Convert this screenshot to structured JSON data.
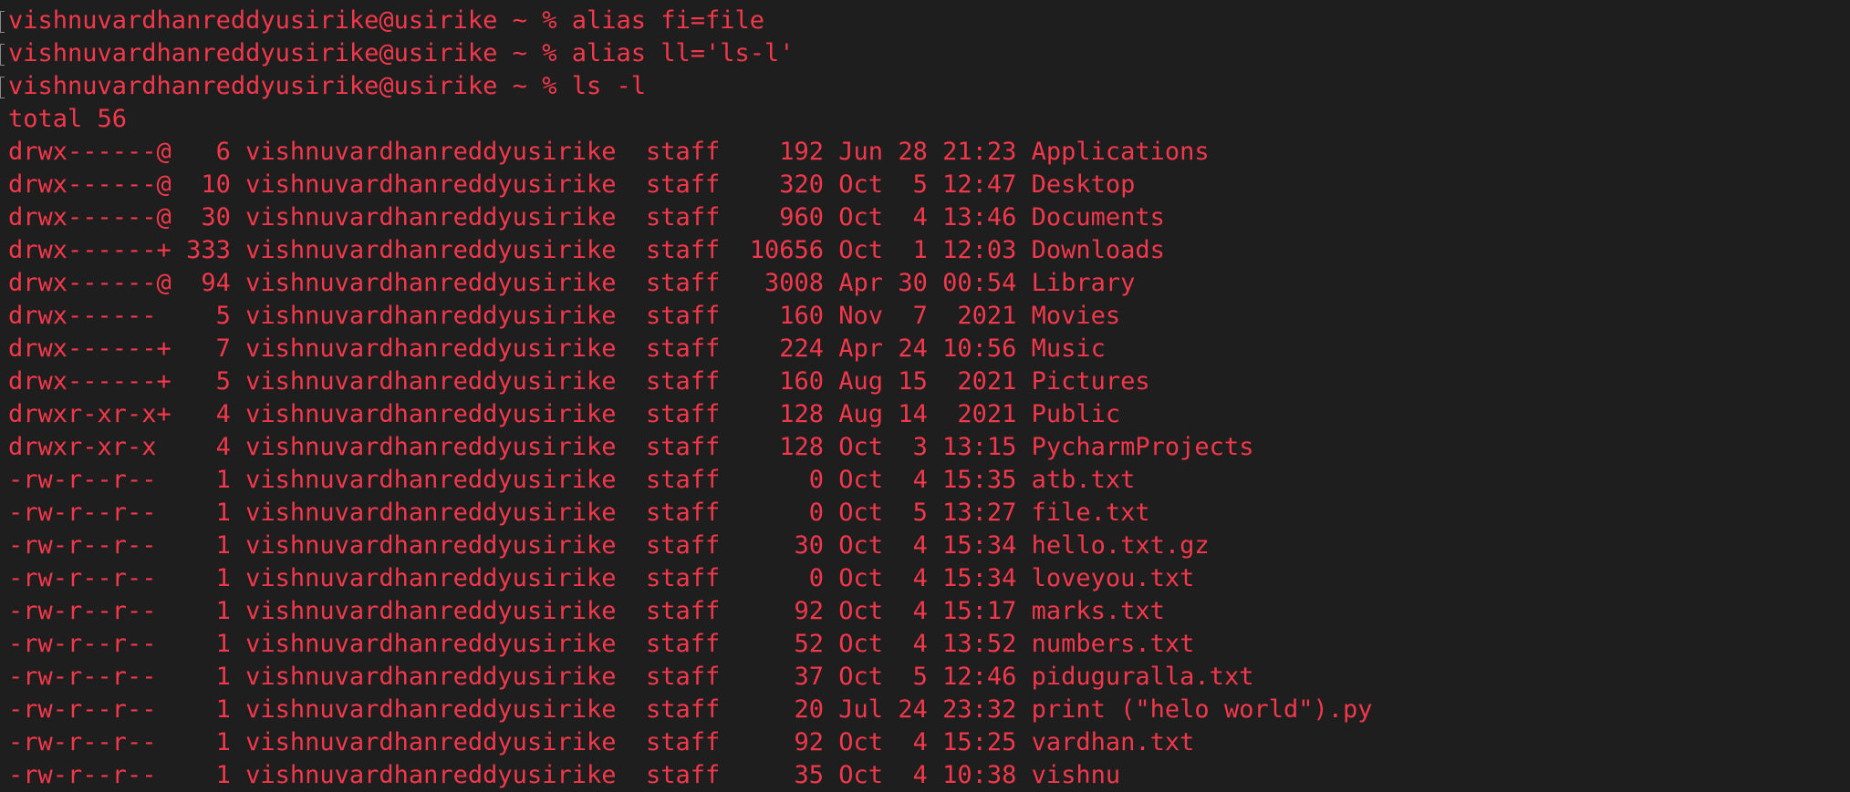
{
  "terminal": {
    "foreground_color": "#f2384a",
    "background_color": "#1e1e1e",
    "lines": [
      {
        "text": "vishnuvardhanreddyusirike@usirike ~ % alias fi=file",
        "prompt": true
      },
      {
        "text": "vishnuvardhanreddyusirike@usirike ~ % alias ll='ls-l'",
        "prompt": true
      },
      {
        "text": "vishnuvardhanreddyusirike@usirike ~ % ls -l",
        "prompt": true
      },
      {
        "text": "total 56",
        "prompt": false
      },
      {
        "text": "drwx------@   6 vishnuvardhanreddyusirike  staff    192 Jun 28 21:23 Applications",
        "prompt": false
      },
      {
        "text": "drwx------@  10 vishnuvardhanreddyusirike  staff    320 Oct  5 12:47 Desktop",
        "prompt": false
      },
      {
        "text": "drwx------@  30 vishnuvardhanreddyusirike  staff    960 Oct  4 13:46 Documents",
        "prompt": false
      },
      {
        "text": "drwx------+ 333 vishnuvardhanreddyusirike  staff  10656 Oct  1 12:03 Downloads",
        "prompt": false
      },
      {
        "text": "drwx------@  94 vishnuvardhanreddyusirike  staff   3008 Apr 30 00:54 Library",
        "prompt": false
      },
      {
        "text": "drwx------    5 vishnuvardhanreddyusirike  staff    160 Nov  7  2021 Movies",
        "prompt": false
      },
      {
        "text": "drwx------+   7 vishnuvardhanreddyusirike  staff    224 Apr 24 10:56 Music",
        "prompt": false
      },
      {
        "text": "drwx------+   5 vishnuvardhanreddyusirike  staff    160 Aug 15  2021 Pictures",
        "prompt": false
      },
      {
        "text": "drwxr-xr-x+   4 vishnuvardhanreddyusirike  staff    128 Aug 14  2021 Public",
        "prompt": false
      },
      {
        "text": "drwxr-xr-x    4 vishnuvardhanreddyusirike  staff    128 Oct  3 13:15 PycharmProjects",
        "prompt": false
      },
      {
        "text": "-rw-r--r--    1 vishnuvardhanreddyusirike  staff      0 Oct  4 15:35 atb.txt",
        "prompt": false
      },
      {
        "text": "-rw-r--r--    1 vishnuvardhanreddyusirike  staff      0 Oct  5 13:27 file.txt",
        "prompt": false
      },
      {
        "text": "-rw-r--r--    1 vishnuvardhanreddyusirike  staff     30 Oct  4 15:34 hello.txt.gz",
        "prompt": false
      },
      {
        "text": "-rw-r--r--    1 vishnuvardhanreddyusirike  staff      0 Oct  4 15:34 loveyou.txt",
        "prompt": false
      },
      {
        "text": "-rw-r--r--    1 vishnuvardhanreddyusirike  staff     92 Oct  4 15:17 marks.txt",
        "prompt": false
      },
      {
        "text": "-rw-r--r--    1 vishnuvardhanreddyusirike  staff     52 Oct  4 13:52 numbers.txt",
        "prompt": false
      },
      {
        "text": "-rw-r--r--    1 vishnuvardhanreddyusirike  staff     37 Oct  5 12:46 piduguralla.txt",
        "prompt": false
      },
      {
        "text": "-rw-r--r--    1 vishnuvardhanreddyusirike  staff     20 Jul 24 23:32 print (\"helo world\").py",
        "prompt": false
      },
      {
        "text": "-rw-r--r--    1 vishnuvardhanreddyusirike  staff     92 Oct  4 15:25 vardhan.txt",
        "prompt": false
      },
      {
        "text": "-rw-r--r--    1 vishnuvardhanreddyusirike  staff     35 Oct  4 10:38 vishnu",
        "prompt": false
      }
    ]
  }
}
